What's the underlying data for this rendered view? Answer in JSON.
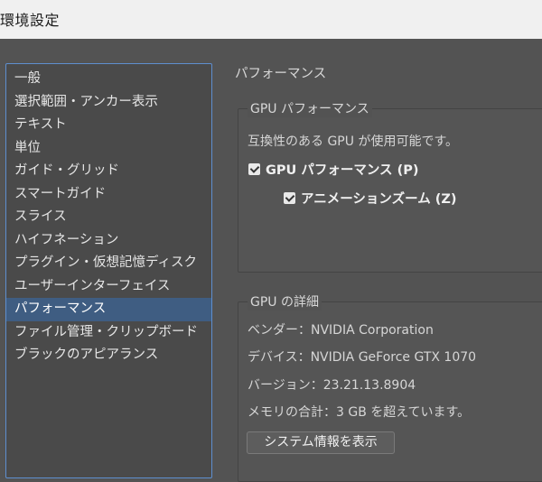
{
  "window": {
    "title": "環境設定"
  },
  "sidebar": {
    "items": [
      {
        "label": "一般"
      },
      {
        "label": "選択範囲・アンカー表示"
      },
      {
        "label": "テキスト"
      },
      {
        "label": "単位"
      },
      {
        "label": "ガイド・グリッド"
      },
      {
        "label": "スマートガイド"
      },
      {
        "label": "スライス"
      },
      {
        "label": "ハイフネーション"
      },
      {
        "label": "プラグイン・仮想記憶ディスク"
      },
      {
        "label": "ユーザーインターフェイス"
      },
      {
        "label": "パフォーマンス",
        "selected": true
      },
      {
        "label": "ファイル管理・クリップボード"
      },
      {
        "label": "ブラックのアピアランス"
      }
    ]
  },
  "main": {
    "section_title": "パフォーマンス",
    "gpu_performance": {
      "group_title": "GPU パフォーマンス",
      "compat_text": "互換性のある GPU が使用可能です。",
      "gpu_checkbox": {
        "label": "GPU パフォーマンス (P)",
        "checked": true
      },
      "animation_checkbox": {
        "label": "アニメーションズーム (Z)",
        "checked": true
      }
    },
    "gpu_details": {
      "group_title": "GPU の詳細",
      "vendor": "ベンダー：NVIDIA Corporation",
      "device": "デバイス：NVIDIA GeForce GTX 1070",
      "version": "バージョン：23.21.13.8904",
      "memory": "メモリの合計：3 GB を超えています。",
      "system_info_button": "システム情報を表示"
    }
  },
  "colors": {
    "background": "#535353",
    "selection": "#3f5d82",
    "focus_border": "#5e8fcf"
  }
}
